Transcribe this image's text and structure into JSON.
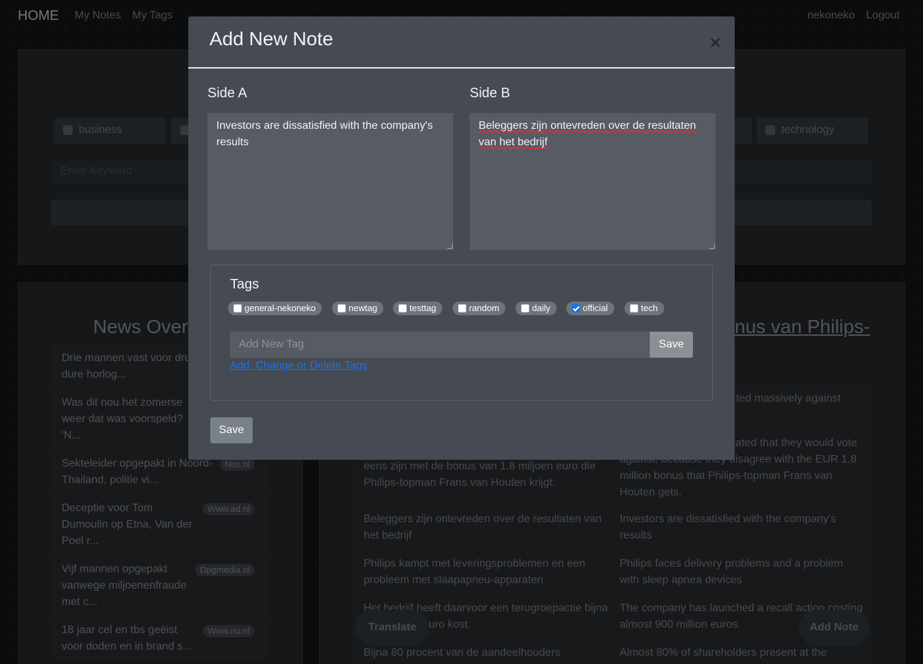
{
  "navbar": {
    "brand": "HOME",
    "links": [
      "My Notes",
      "My Tags"
    ],
    "user": "nekoneko",
    "logout": "Logout"
  },
  "filter": {
    "tags_visible": [
      "business",
      "technology"
    ],
    "keyword_placeholder": "Enter Keyword"
  },
  "news": {
    "heading_partial": "News Over",
    "items": [
      {
        "text": "Drie mannen vast voor dru ton cash, dure horlog...",
        "source": ""
      },
      {
        "text": "Was dit nou het zomerse weer dat was voorspeld? 'N...",
        "source": ""
      },
      {
        "text": "Sekteleider opgepakt in Noord-Thailand, politie vi...",
        "source": "Nos.nl"
      },
      {
        "text": "Deceptie voor Tom Dumoulin op Etna, Van der Poel r...",
        "source": "Www.ad.nl"
      },
      {
        "text": "Vijf mannen opgepakt vanwege miljoenenfraude met c...",
        "source": "Dpgmedia.nl"
      },
      {
        "text": "18 jaar cel en tbs geëist voor doden en in brand s...",
        "source": "Www.nu.nl"
      }
    ]
  },
  "article": {
    "title_partial": "nus van Philips-",
    "pairs": [
      {
        "a": "",
        "b": "ted massively against"
      },
      {
        "a": "aangegeven tegen te stemmen, omdat ze het niet eens zijn met de bonus van 1,8 miljoen euro die Philips-topman Frans van Houten krijgt.",
        "b": "estors had already indicated that they would vote against, because they disagree with the EUR 1.8 million bonus that Philips-topman Frans van Houten gets."
      },
      {
        "a": "Beleggers zijn ontevreden over de resultaten van het bedrijf",
        "b": "Investors are dissatisfied with the company's results"
      },
      {
        "a": "Philips kampt met leveringsproblemen en een probleem met slaapapneu-apparaten",
        "b": "Philips faces delivery problems and a problem with sleep apnea devices"
      },
      {
        "a": "Het bedrijf heeft daarvoor een terugroepactie bijna 900 miljoen euro kost.",
        "b": "The company has launched a recall action costing almost 900 million euros."
      },
      {
        "a": "Bijna 80 procent van de aandeelhouders",
        "b": "Almost 80% of shareholders present at the"
      }
    ]
  },
  "floating": {
    "translate": "Translate",
    "add_note": "Add Note"
  },
  "modal": {
    "title": "Add New Note",
    "close_symbol": "×",
    "side_a_label": "Side A",
    "side_b_label": "Side B",
    "side_a_value": "Investors are dissatisfied with the company's results",
    "side_b_value": "Beleggers zijn ontevreden over de resultaten van het bedrijf",
    "tags_heading": "Tags",
    "tags": [
      {
        "label": "general-nekoneko",
        "checked": false
      },
      {
        "label": "newtag",
        "checked": false
      },
      {
        "label": "testtag",
        "checked": false
      },
      {
        "label": "random",
        "checked": false
      },
      {
        "label": "daily",
        "checked": false
      },
      {
        "label": "official",
        "checked": true
      },
      {
        "label": "tech",
        "checked": false
      }
    ],
    "new_tag_placeholder": "Add New Tag",
    "new_tag_save": "Save",
    "manage_tags_link": "Add, Change or Delete Tags",
    "save": "Save"
  },
  "colors": {
    "modal_bg": "#464a52",
    "accent_link": "#1a73e8",
    "checkbox_checked": "#1a73e8"
  }
}
